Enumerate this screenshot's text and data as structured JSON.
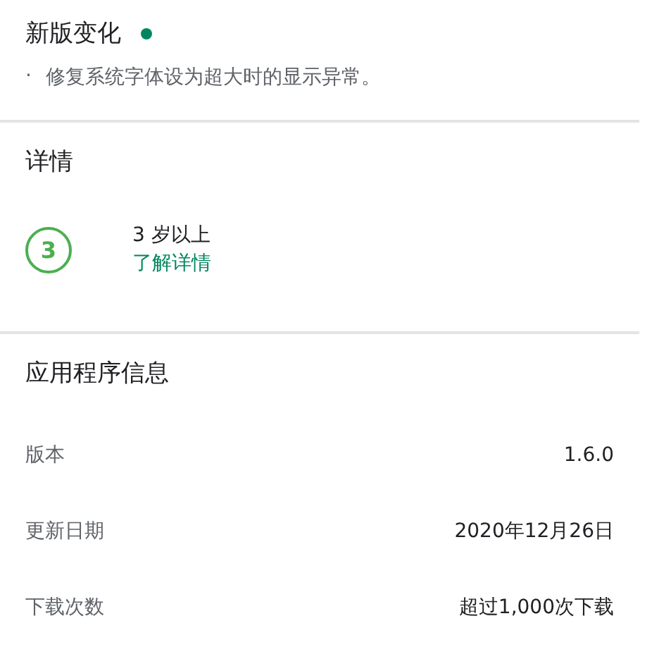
{
  "whats_new": {
    "title": "新版变化",
    "notes": [
      {
        "bullet": "·",
        "text": "修复系统字体设为超大时的显示异常。"
      }
    ]
  },
  "details": {
    "title": "详情",
    "rating": {
      "badge": "3",
      "label": "3 岁以上",
      "link": "了解详情"
    }
  },
  "app_info": {
    "title": "应用程序信息",
    "rows": [
      {
        "label": "版本",
        "value": "1.6.0"
      },
      {
        "label": "更新日期",
        "value": "2020年12月26日"
      },
      {
        "label": "下载次数",
        "value": "超过1,000次下载"
      }
    ]
  }
}
